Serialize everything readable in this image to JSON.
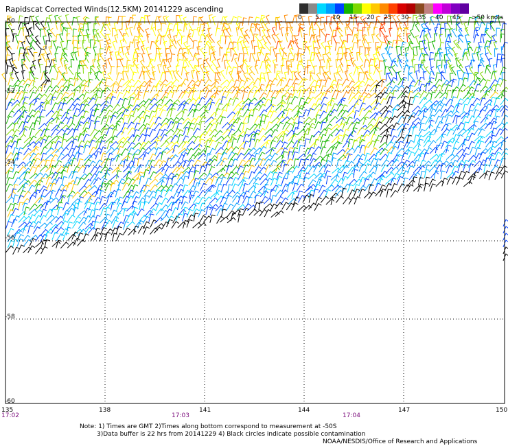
{
  "title": "Rapidscat Corrected Winds(12.5KM) 20141229 ascending",
  "legend": {
    "unit_label": ">50 knots",
    "labels": [
      "0",
      "5",
      "10",
      "15",
      "20",
      "25",
      "30",
      "35",
      "40",
      "45"
    ],
    "colors": [
      "#2e2e2e",
      "#8a8a8a",
      "#00d8ff",
      "#00a0ff",
      "#0040ff",
      "#16b400",
      "#7dd800",
      "#ffff00",
      "#ffc800",
      "#ff8a00",
      "#ff4000",
      "#d80000",
      "#b00000",
      "#8a4a20",
      "#c08080",
      "#ff00ff",
      "#c000d8",
      "#8000c0",
      "#6000a0"
    ]
  },
  "axes": {
    "lat_labels": [
      "-50",
      "-52",
      "-54",
      "-56",
      "-58",
      "-60"
    ],
    "lon_labels": [
      "135",
      "138",
      "141",
      "144",
      "147",
      "150"
    ]
  },
  "times": [
    "17:02",
    "17:03",
    "17:04"
  ],
  "notes": {
    "line1": "Note: 1) Times are GMT 2)Times along bottom correspond to measurement at -50S",
    "line2": "3)Data buffer is 22 hrs from 20141229 4) Black circles indicate possible contamination",
    "credit": "NOAA/NESDIS/Office of Research and Applications"
  }
}
